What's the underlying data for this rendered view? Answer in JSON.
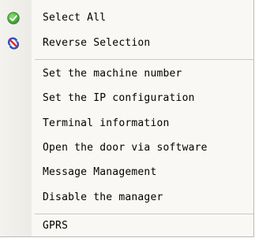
{
  "menu": {
    "items": [
      {
        "label": "Select All",
        "icon": "green-check-icon"
      },
      {
        "label": "Reverse Selection",
        "icon": "reverse-selection-icon"
      },
      {
        "label": "Set the machine number"
      },
      {
        "label": "Set the IP configuration"
      },
      {
        "label": "Terminal information"
      },
      {
        "label": "Open the door via software"
      },
      {
        "label": "Message Management"
      },
      {
        "label": "Disable the manager"
      },
      {
        "label": "GPRS"
      }
    ]
  },
  "colors": {
    "check_green": "#3cab2a",
    "reverse_blue": "#2a4fc4",
    "reverse_red": "#e02020"
  }
}
